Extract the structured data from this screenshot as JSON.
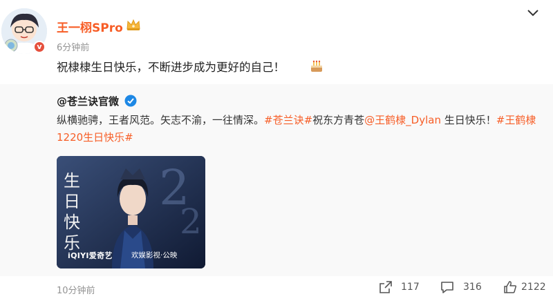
{
  "post": {
    "username": "王一栩SPro",
    "time": "6分钟前",
    "text": "祝棣棣生日快乐，不断进步成为更好的自己！"
  },
  "repost": {
    "author": "@苍兰诀官微",
    "segments": [
      {
        "text": "纵横驰骋，王者风范。矢志不渝，一往情深。",
        "link": false
      },
      {
        "text": "#苍兰诀#",
        "link": true
      },
      {
        "text": "祝东方青苍",
        "link": false
      },
      {
        "text": "@王鹤棣_Dylan",
        "link": true
      },
      {
        "text": " 生日快乐！",
        "link": false
      },
      {
        "text": "#王鹤棣1220生日快乐#",
        "link": true
      }
    ],
    "image_caption_left": "iQIYI爱奇艺",
    "image_caption_right": "欢娱影视·公映",
    "time": "10分钟前",
    "counts": {
      "reposts": "117",
      "comments": "316",
      "likes": "2122"
    }
  },
  "icons": {
    "crown": "crown-icon",
    "menu": "chevron-down-icon",
    "cake": "cake-icon",
    "verified": "verified-icon",
    "share": "share-icon",
    "comment": "comment-icon",
    "like": "thumbs-up-icon"
  },
  "colors": {
    "username": "#f75d26",
    "link": "#f75d26",
    "muted": "#939393",
    "verified_orange": "#e5503d",
    "verified_blue": "#1e88e5",
    "repost_bg": "#f9f9f9"
  }
}
